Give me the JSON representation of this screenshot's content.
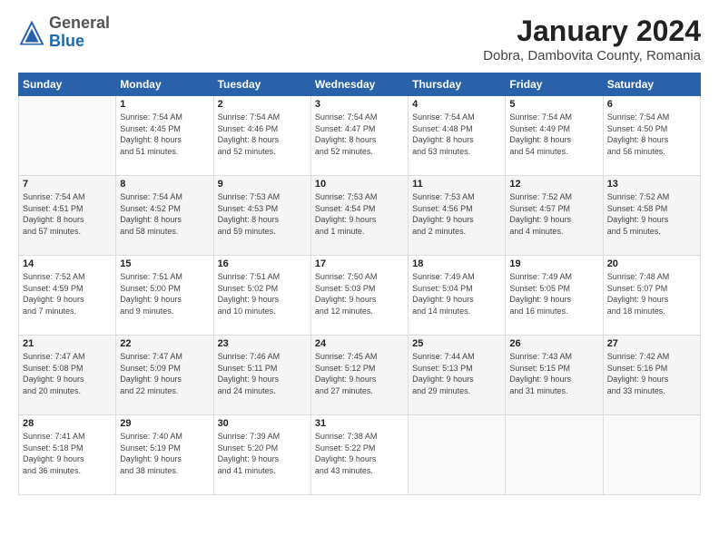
{
  "header": {
    "logo": {
      "general": "General",
      "blue": "Blue"
    },
    "title": "January 2024",
    "location": "Dobra, Dambovita County, Romania"
  },
  "days_of_week": [
    "Sunday",
    "Monday",
    "Tuesday",
    "Wednesday",
    "Thursday",
    "Friday",
    "Saturday"
  ],
  "weeks": [
    [
      {
        "day": "",
        "info": ""
      },
      {
        "day": "1",
        "info": "Sunrise: 7:54 AM\nSunset: 4:45 PM\nDaylight: 8 hours\nand 51 minutes."
      },
      {
        "day": "2",
        "info": "Sunrise: 7:54 AM\nSunset: 4:46 PM\nDaylight: 8 hours\nand 52 minutes."
      },
      {
        "day": "3",
        "info": "Sunrise: 7:54 AM\nSunset: 4:47 PM\nDaylight: 8 hours\nand 52 minutes."
      },
      {
        "day": "4",
        "info": "Sunrise: 7:54 AM\nSunset: 4:48 PM\nDaylight: 8 hours\nand 53 minutes."
      },
      {
        "day": "5",
        "info": "Sunrise: 7:54 AM\nSunset: 4:49 PM\nDaylight: 8 hours\nand 54 minutes."
      },
      {
        "day": "6",
        "info": "Sunrise: 7:54 AM\nSunset: 4:50 PM\nDaylight: 8 hours\nand 56 minutes."
      }
    ],
    [
      {
        "day": "7",
        "info": "Sunrise: 7:54 AM\nSunset: 4:51 PM\nDaylight: 8 hours\nand 57 minutes."
      },
      {
        "day": "8",
        "info": "Sunrise: 7:54 AM\nSunset: 4:52 PM\nDaylight: 8 hours\nand 58 minutes."
      },
      {
        "day": "9",
        "info": "Sunrise: 7:53 AM\nSunset: 4:53 PM\nDaylight: 8 hours\nand 59 minutes."
      },
      {
        "day": "10",
        "info": "Sunrise: 7:53 AM\nSunset: 4:54 PM\nDaylight: 9 hours\nand 1 minute."
      },
      {
        "day": "11",
        "info": "Sunrise: 7:53 AM\nSunset: 4:56 PM\nDaylight: 9 hours\nand 2 minutes."
      },
      {
        "day": "12",
        "info": "Sunrise: 7:52 AM\nSunset: 4:57 PM\nDaylight: 9 hours\nand 4 minutes."
      },
      {
        "day": "13",
        "info": "Sunrise: 7:52 AM\nSunset: 4:58 PM\nDaylight: 9 hours\nand 5 minutes."
      }
    ],
    [
      {
        "day": "14",
        "info": "Sunrise: 7:52 AM\nSunset: 4:59 PM\nDaylight: 9 hours\nand 7 minutes."
      },
      {
        "day": "15",
        "info": "Sunrise: 7:51 AM\nSunset: 5:00 PM\nDaylight: 9 hours\nand 9 minutes."
      },
      {
        "day": "16",
        "info": "Sunrise: 7:51 AM\nSunset: 5:02 PM\nDaylight: 9 hours\nand 10 minutes."
      },
      {
        "day": "17",
        "info": "Sunrise: 7:50 AM\nSunset: 5:03 PM\nDaylight: 9 hours\nand 12 minutes."
      },
      {
        "day": "18",
        "info": "Sunrise: 7:49 AM\nSunset: 5:04 PM\nDaylight: 9 hours\nand 14 minutes."
      },
      {
        "day": "19",
        "info": "Sunrise: 7:49 AM\nSunset: 5:05 PM\nDaylight: 9 hours\nand 16 minutes."
      },
      {
        "day": "20",
        "info": "Sunrise: 7:48 AM\nSunset: 5:07 PM\nDaylight: 9 hours\nand 18 minutes."
      }
    ],
    [
      {
        "day": "21",
        "info": "Sunrise: 7:47 AM\nSunset: 5:08 PM\nDaylight: 9 hours\nand 20 minutes."
      },
      {
        "day": "22",
        "info": "Sunrise: 7:47 AM\nSunset: 5:09 PM\nDaylight: 9 hours\nand 22 minutes."
      },
      {
        "day": "23",
        "info": "Sunrise: 7:46 AM\nSunset: 5:11 PM\nDaylight: 9 hours\nand 24 minutes."
      },
      {
        "day": "24",
        "info": "Sunrise: 7:45 AM\nSunset: 5:12 PM\nDaylight: 9 hours\nand 27 minutes."
      },
      {
        "day": "25",
        "info": "Sunrise: 7:44 AM\nSunset: 5:13 PM\nDaylight: 9 hours\nand 29 minutes."
      },
      {
        "day": "26",
        "info": "Sunrise: 7:43 AM\nSunset: 5:15 PM\nDaylight: 9 hours\nand 31 minutes."
      },
      {
        "day": "27",
        "info": "Sunrise: 7:42 AM\nSunset: 5:16 PM\nDaylight: 9 hours\nand 33 minutes."
      }
    ],
    [
      {
        "day": "28",
        "info": "Sunrise: 7:41 AM\nSunset: 5:18 PM\nDaylight: 9 hours\nand 36 minutes."
      },
      {
        "day": "29",
        "info": "Sunrise: 7:40 AM\nSunset: 5:19 PM\nDaylight: 9 hours\nand 38 minutes."
      },
      {
        "day": "30",
        "info": "Sunrise: 7:39 AM\nSunset: 5:20 PM\nDaylight: 9 hours\nand 41 minutes."
      },
      {
        "day": "31",
        "info": "Sunrise: 7:38 AM\nSunset: 5:22 PM\nDaylight: 9 hours\nand 43 minutes."
      },
      {
        "day": "",
        "info": ""
      },
      {
        "day": "",
        "info": ""
      },
      {
        "day": "",
        "info": ""
      }
    ]
  ]
}
